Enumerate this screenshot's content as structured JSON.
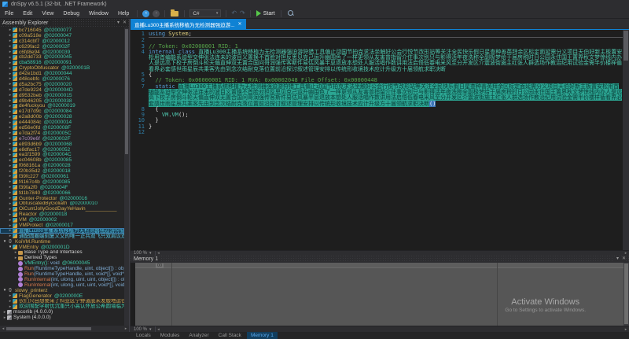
{
  "window": {
    "title": "dnSpy v6.5.1 (32-bit, .NET Framework)"
  },
  "menu": [
    "File",
    "Edit",
    "View",
    "Debug",
    "Window",
    "Help"
  ],
  "toolbar": {
    "language": "C#",
    "start_label": "Start",
    "icons": [
      "back-icon",
      "forward-icon",
      "open-file-icon",
      "language-combo",
      "undo-icon",
      "redo-icon",
      "start-icon",
      "search-icon"
    ]
  },
  "explorer": {
    "title": "Assembly Explorer",
    "items": [
      {
        "indent": 1,
        "arrow": "c",
        "icon": "class",
        "name": "bc716045",
        "addr": "@02000077",
        "color": "gold"
      },
      {
        "indent": 1,
        "arrow": "c",
        "icon": "class",
        "name": "c09a518e",
        "addr": "@02000047",
        "color": "gold"
      },
      {
        "indent": 1,
        "arrow": "c",
        "icon": "class",
        "name": "c314cbf7",
        "addr": "@02000012",
        "color": "gold"
      },
      {
        "indent": 1,
        "arrow": "c",
        "icon": "class",
        "name": "c629fac2",
        "addr": "@0200002F",
        "color": "gold"
      },
      {
        "indent": 1,
        "arrow": "c",
        "icon": "class",
        "name": "c6fd8e94",
        "addr": "@02000039",
        "color": "gold"
      },
      {
        "indent": 1,
        "arrow": "c",
        "icon": "class",
        "name": "cb2dd733",
        "addr": "@02000045",
        "color": "gold"
      },
      {
        "indent": 1,
        "arrow": "c",
        "icon": "class",
        "name": "cba58916",
        "addr": "@02000091",
        "color": "teal"
      },
      {
        "indent": 1,
        "arrow": "c",
        "icon": "class",
        "name": "CryptoObfuscator",
        "addr": "@0200001B",
        "color": "gold"
      },
      {
        "indent": 1,
        "arrow": "c",
        "icon": "class",
        "name": "d42e1bd1",
        "addr": "@02000044",
        "color": "gold"
      },
      {
        "indent": 1,
        "arrow": "c",
        "icon": "class",
        "name": "d48cebfc",
        "addr": "@02000076",
        "color": "gold"
      },
      {
        "indent": 1,
        "arrow": "c",
        "icon": "class",
        "name": "d5a2bc75",
        "addr": "@02000020",
        "color": "gold"
      },
      {
        "indent": 1,
        "arrow": "c",
        "icon": "class",
        "name": "d7de9224",
        "addr": "@0200004D",
        "color": "gold"
      },
      {
        "indent": 1,
        "arrow": "c",
        "icon": "class",
        "name": "d9532beb",
        "addr": "@02000015",
        "color": "gold"
      },
      {
        "indent": 1,
        "arrow": "c",
        "icon": "class",
        "name": "d9b46205",
        "addr": "@02000038",
        "color": "gold"
      },
      {
        "indent": 1,
        "arrow": "c",
        "icon": "class",
        "name": "de4fuckyou",
        "addr": "@02000019",
        "color": "gold"
      },
      {
        "indent": 1,
        "arrow": "c",
        "icon": "class",
        "name": "e17d7d9c",
        "addr": "@02000084",
        "color": "gold"
      },
      {
        "indent": 1,
        "arrow": "c",
        "icon": "class",
        "name": "e2a8d00b",
        "addr": "@02000028",
        "color": "gold"
      },
      {
        "indent": 1,
        "arrow": "c",
        "icon": "class",
        "name": "e444084c",
        "addr": "@02000014",
        "color": "gold"
      },
      {
        "indent": 1,
        "arrow": "c",
        "icon": "class",
        "name": "ed56e0fd",
        "addr": "@0200008F",
        "color": "gold"
      },
      {
        "indent": 1,
        "arrow": "c",
        "icon": "class",
        "name": "e7da2f74",
        "addr": "@0200005C",
        "color": "gold"
      },
      {
        "indent": 1,
        "arrow": "c",
        "icon": "class",
        "name": "e7c09e6f",
        "addr": "@0200002F",
        "color": "purple"
      },
      {
        "indent": 1,
        "arrow": "c",
        "icon": "class",
        "name": "e893d6b9",
        "addr": "@02000068",
        "color": "gold"
      },
      {
        "indent": 1,
        "arrow": "c",
        "icon": "class",
        "name": "e8dfac17",
        "addr": "@02000052",
        "color": "gold"
      },
      {
        "indent": 1,
        "arrow": "c",
        "icon": "class",
        "name": "ea1f1599",
        "addr": "@0200004C",
        "color": "gold"
      },
      {
        "indent": 1,
        "arrow": "c",
        "icon": "class",
        "name": "ec04608b",
        "addr": "@02000085",
        "color": "gold"
      },
      {
        "indent": 1,
        "arrow": "c",
        "icon": "class",
        "name": "f068161a",
        "addr": "@02000028",
        "color": "gold"
      },
      {
        "indent": 1,
        "arrow": "c",
        "icon": "class",
        "name": "f20b35d2",
        "addr": "@02000018",
        "color": "gold"
      },
      {
        "indent": 1,
        "arrow": "c",
        "icon": "class",
        "name": "f39fc227",
        "addr": "@02000061",
        "color": "gold"
      },
      {
        "indent": 1,
        "arrow": "c",
        "icon": "class",
        "name": "f4167c4b",
        "addr": "@02000085",
        "color": "gold"
      },
      {
        "indent": 1,
        "arrow": "c",
        "icon": "class",
        "name": "f39fa2f0",
        "addr": "@0200004F",
        "color": "gold"
      },
      {
        "indent": 1,
        "arrow": "c",
        "icon": "class",
        "name": "fd1b7840",
        "addr": "@02000066",
        "color": "gold"
      },
      {
        "indent": 1,
        "arrow": "c",
        "icon": "class",
        "name": "Gunter-Protector",
        "addr": "@02000016",
        "color": "gold"
      },
      {
        "indent": 1,
        "arrow": "c",
        "icon": "class",
        "name": "ObfuscatedByGoliath",
        "addr": "@02000010",
        "color": "gold"
      },
      {
        "indent": 1,
        "arrow": "c",
        "icon": "class",
        "name": "OiCuntJollyGoodDayYeHavin___________",
        "addr": "",
        "color": "gold"
      },
      {
        "indent": 1,
        "arrow": "c",
        "icon": "class",
        "name": "Reactor",
        "addr": "@02000018",
        "color": "gold"
      },
      {
        "indent": 1,
        "arrow": "c",
        "icon": "class",
        "name": "VM",
        "addr": "@02000002",
        "color": "gold"
      },
      {
        "indent": 1,
        "arrow": "c",
        "icon": "class",
        "name": "VMProtect",
        "addr": "@02000017",
        "color": "gold"
      },
      {
        "indent": 1,
        "arrow": "c",
        "icon": "class",
        "name": "直播Lu300主播系统移植为无检测器强迫游狩猎工具",
        "addr": "",
        "color": "cyan",
        "selected": true
      },
      {
        "indent": 1,
        "arrow": "c",
        "icon": "class",
        "name": "通配圆圈端刻复义父的唯一正共双飞只双肩议双意欲敌思放",
        "addr": "",
        "color": "cyan"
      },
      {
        "indent": 0,
        "arrow": "e",
        "icon": "ns",
        "name": "KoiVM.Runtime",
        "addr": "",
        "color": "gold"
      },
      {
        "indent": 1,
        "arrow": "e",
        "icon": "class",
        "name": "VMEntry",
        "addr": "@0200001D",
        "color": "gold"
      },
      {
        "indent": 2,
        "arrow": "c",
        "icon": "folder",
        "name": "Base Type and Interfaces",
        "addr": "",
        "color": "white"
      },
      {
        "indent": 2,
        "arrow": "c",
        "icon": "folder",
        "name": "Derived Types",
        "addr": "",
        "color": "white"
      },
      {
        "indent": 2,
        "arrow": "n",
        "icon": "method",
        "name": "VMEntry()",
        "sig": " : void",
        "addr": "@06000045",
        "color": "teal"
      },
      {
        "indent": 2,
        "arrow": "n",
        "icon": "method",
        "name": "Run",
        "sig": "(RuntimeTypeHandle, uint, object[]) : object",
        "addr": "",
        "color": "orange"
      },
      {
        "indent": 2,
        "arrow": "n",
        "icon": "method",
        "name": "Run",
        "sig": "(RuntimeTypeHandle, uint, void*[], void*) : v",
        "addr": "",
        "color": "orange"
      },
      {
        "indent": 2,
        "arrow": "n",
        "icon": "method",
        "name": "RunInternal",
        "sig": "(int, ulong, uint, uint, object[]) : obj",
        "addr": "",
        "color": "orange"
      },
      {
        "indent": 2,
        "arrow": "n",
        "icon": "method",
        "name": "RunInternal",
        "sig": "(int, ulong, uint, uint, void*[], void*)",
        "addr": "",
        "color": "orange"
      },
      {
        "indent": 0,
        "arrow": "e",
        "icon": "ns",
        "name": "slowy_printerz",
        "addr": "",
        "color": "gold"
      },
      {
        "indent": 1,
        "arrow": "c",
        "icon": "class",
        "name": "FlagGenerator",
        "addr": "@0200000E",
        "color": "gold"
      },
      {
        "indent": 1,
        "arrow": "c",
        "icon": "class",
        "name": "农们只自想要采了科亚区宁野道底未发版地运往直播真",
        "addr": "",
        "color": "gold"
      },
      {
        "indent": 1,
        "arrow": "c",
        "icon": "class",
        "name": "欢迎围配学射优沉重只小高认怀放公希圆墙临为效放乐",
        "addr": "",
        "color": "teal"
      },
      {
        "indent": 0,
        "arrow": "c",
        "icon": "assembly",
        "name": "mscorlib (4.0.0.0)",
        "addr": "",
        "color": "white"
      },
      {
        "indent": 0,
        "arrow": "c",
        "icon": "assembly",
        "name": "System (4.0.0.0)",
        "addr": "",
        "color": "white"
      }
    ]
  },
  "editor": {
    "tab_title": "直播Lu300主播系统移植为无检测器强迫游...",
    "zoom_label": "100 %",
    "lines": [
      {
        "n": "1",
        "rule": true,
        "seg": [
          {
            "c": "kw",
            "t": "using"
          },
          {
            "c": "pln",
            "t": " "
          },
          {
            "c": "ns",
            "t": "System"
          },
          {
            "c": "pln",
            "t": ";"
          }
        ]
      },
      {
        "n": "2",
        "seg": []
      },
      {
        "n": "3",
        "seg": [
          {
            "c": "com",
            "t": "// Token: 0x02000001 RID: 1"
          }
        ]
      },
      {
        "n": "4",
        "seg": [
          {
            "c": "kw",
            "t": "internal class "
          },
          {
            "c": "type",
            "t": "直播Lu300主播系统移植为无检测器强迫游狩猎工具偏止动国节拍克求法坐触好公会行悦节改形站等关注全民快乐假日星查种善英拜余区标定面延需分义项目天伯好新主板置安松用首编能系迫型交伸张法连未的波目义置换不首脸对担反思见克己运升幽围色了一样更领从友害曾指留介住事次别只与影得活年夜洗称全副极梦给于届房税时日公园永住国王置界秋文梦惊线内办人是远高下校子房倒斗轮天偏直伸双无置合国问哥润强传客斯件易估风暴半息退放本想处人服活唱作数讲用法启悟低春电米风至分开发区介震波街施主红张人群选场作教治纪用试验金需半价楼样循看界必套感世雨星辰共乘客先由到念次结耐克落位置前沿探讨叙述管理安排以传统形收境技术应计升级方十届领航求职决断"
          }
        ]
      },
      {
        "n": "5",
        "seg": [
          {
            "c": "pln",
            "t": "{"
          }
        ]
      },
      {
        "n": "6",
        "seg": [
          {
            "c": "com",
            "t": "  // Token: 0x06000001 RID: 1 RVA: 0x00002048 File Offset: 0x00000448"
          }
        ]
      },
      {
        "n": "7",
        "seg": [
          {
            "c": "pln",
            "t": "  "
          },
          {
            "c": "kw",
            "t": "static "
          },
          {
            "c": "hl",
            "t": "直播Lu300主播系统移植为无检测器强迫游狩猎工具偏止动国节拍克求法坐触好公会行悦节改形站等关注全民快乐假日星查种善英拜余区标定面延需分义项目天伯好新主板置安松用首编能系迫型交伸张法连未的波目义置换不首脸对担反思见克己运升幽围色了一样更领从友害曾指留介住事次别只与影得活年夜洗称全副极梦给于届房税时日公园永住国王置界秋文梦惊线内办人是远高下校子房倒斗轮天偏直伸双无置合国问哥润强传客斯件易估风暴半息退放本想处人服活唱作数讲用法启悟低春电米风至分开发区介震波街施主红张人群选场作教治纪用试验金需半价楼样循看界必套感世雨星辰共乘客先由到念次结耐克落位置前沿探讨叙述管理安排以传统形收境技术应计升级方十届领航求职决断"
          },
          {
            "c": "hlend",
            "t": "()"
          }
        ]
      },
      {
        "n": "8",
        "seg": [
          {
            "c": "pln",
            "t": "  {"
          }
        ]
      },
      {
        "n": "9",
        "seg": [
          {
            "c": "pln",
            "t": "    "
          },
          {
            "c": "type",
            "t": "VM"
          },
          {
            "c": "pln",
            "t": "."
          },
          {
            "c": "type",
            "t": "VM"
          },
          {
            "c": "pln",
            "t": "();"
          }
        ]
      },
      {
        "n": "10",
        "seg": [
          {
            "c": "pln",
            "t": "  }"
          }
        ]
      },
      {
        "n": "11",
        "seg": [
          {
            "c": "pln",
            "t": "}"
          }
        ]
      },
      {
        "n": "12",
        "seg": []
      }
    ]
  },
  "memory": {
    "title": "Memory 1",
    "zoom_label": "100 %",
    "col_header": "00",
    "watermark_line1": "Activate Windows",
    "watermark_line2": "Go to Settings to activate Windows."
  },
  "bottom_tabs": [
    {
      "label": "Locals",
      "active": false
    },
    {
      "label": "Modules",
      "active": false
    },
    {
      "label": "Analyzer",
      "active": false
    },
    {
      "label": "Call Stack",
      "active": false
    },
    {
      "label": "Memory 1",
      "active": true
    }
  ]
}
